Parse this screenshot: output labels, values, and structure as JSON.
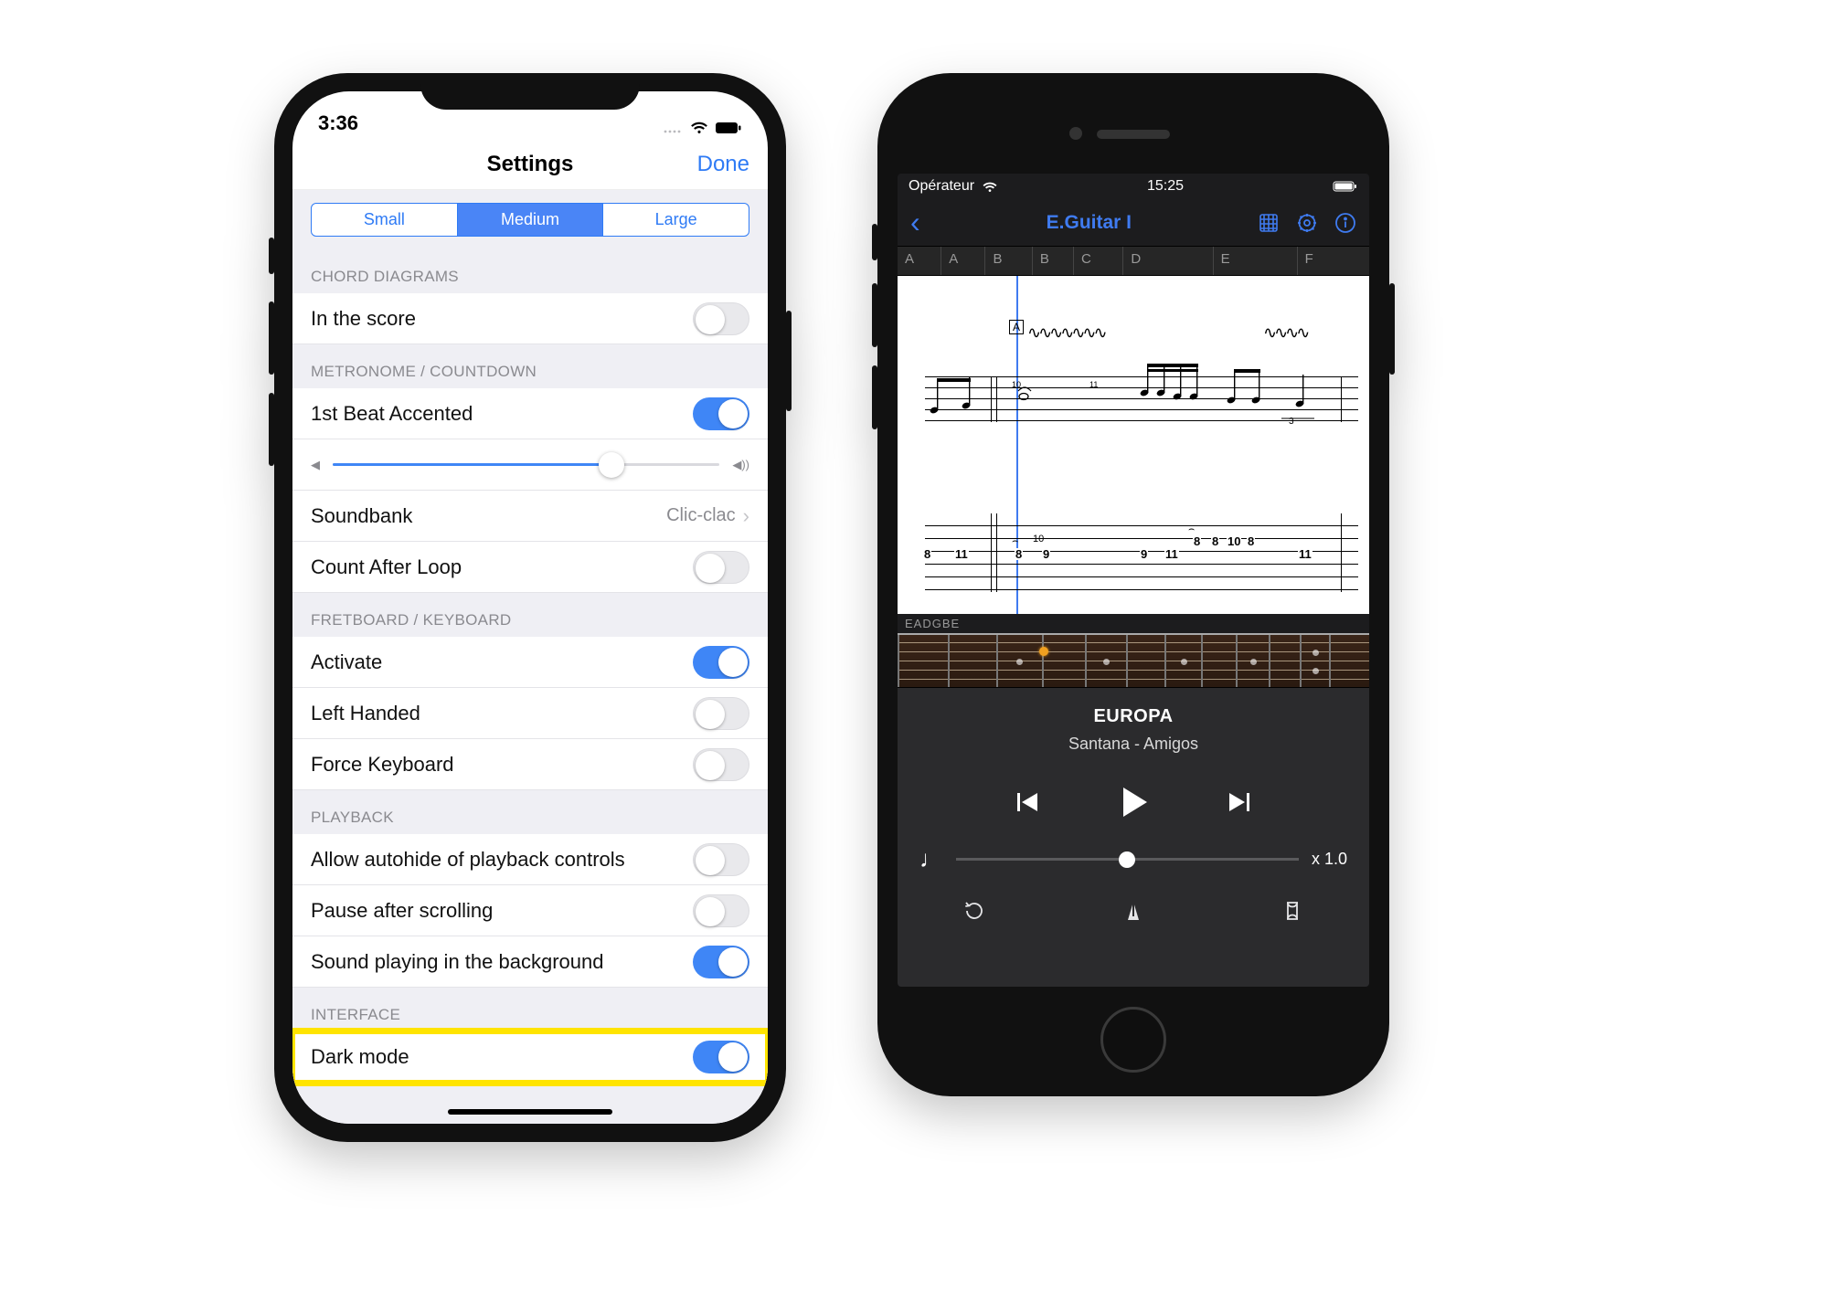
{
  "left": {
    "status_time": "3:36",
    "nav_title": "Settings",
    "nav_done": "Done",
    "segments": {
      "small": "Small",
      "medium": "Medium",
      "large": "Large"
    },
    "grp_chord": "CHORD DIAGRAMS",
    "row_inscore": "In the score",
    "grp_metro": "METRONOME / COUNTDOWN",
    "row_1stbeat": "1st Beat Accented",
    "row_soundbank": "Soundbank",
    "row_soundbank_val": "Clic-clac",
    "row_countafter": "Count After Loop",
    "grp_fret": "FRETBOARD / KEYBOARD",
    "row_activate": "Activate",
    "row_lefthand": "Left Handed",
    "row_forcekb": "Force Keyboard",
    "grp_playback": "PLAYBACK",
    "row_autohide": "Allow autohide of playback controls",
    "row_pausescroll": "Pause after scrolling",
    "row_bgsound": "Sound playing in the background",
    "grp_interface": "INTERFACE",
    "row_darkmode": "Dark mode"
  },
  "right": {
    "status_carrier": "Opérateur",
    "status_time": "15:25",
    "nav_title": "E.Guitar I",
    "sections": [
      "A",
      "A",
      "B",
      "B",
      "C",
      "D",
      "E",
      "F"
    ],
    "rehearsal": "A",
    "tab_numbers": {
      "measure1": {
        "before_bar": [
          "8",
          "11"
        ],
        "after_bar": [
          "8",
          "9",
          "10"
        ],
        "after_bar_fret": [
          "11"
        ]
      },
      "measure2": [
        "9",
        "11",
        "8",
        "8",
        "10",
        "8",
        "11"
      ]
    },
    "tuning": "EADGBE",
    "song_title": "EUROPA",
    "song_artist": "Santana - Amigos",
    "tempo_value": "x 1.0"
  }
}
